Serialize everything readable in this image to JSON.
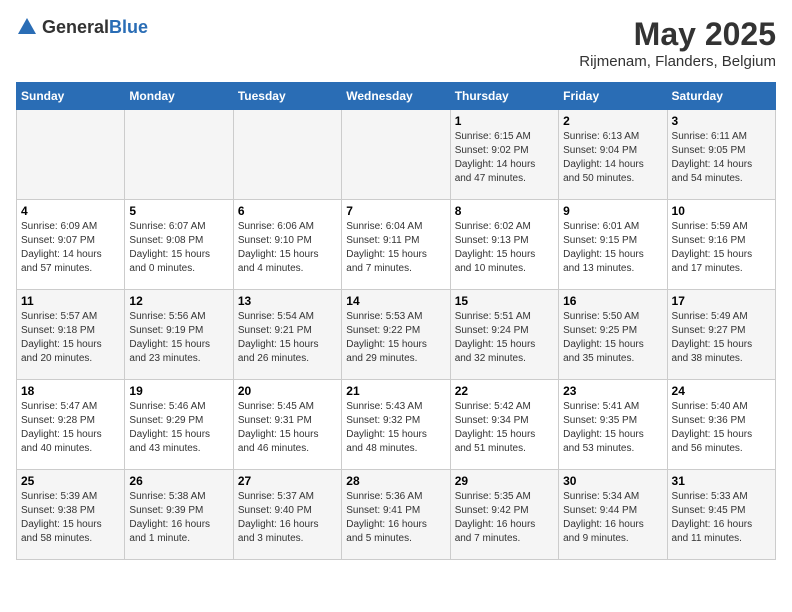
{
  "logo": {
    "text_general": "General",
    "text_blue": "Blue"
  },
  "title": "May 2025",
  "subtitle": "Rijmenam, Flanders, Belgium",
  "days_of_week": [
    "Sunday",
    "Monday",
    "Tuesday",
    "Wednesday",
    "Thursday",
    "Friday",
    "Saturday"
  ],
  "weeks": [
    [
      {
        "day": "",
        "info": ""
      },
      {
        "day": "",
        "info": ""
      },
      {
        "day": "",
        "info": ""
      },
      {
        "day": "",
        "info": ""
      },
      {
        "day": "1",
        "info": "Sunrise: 6:15 AM\nSunset: 9:02 PM\nDaylight: 14 hours\nand 47 minutes."
      },
      {
        "day": "2",
        "info": "Sunrise: 6:13 AM\nSunset: 9:04 PM\nDaylight: 14 hours\nand 50 minutes."
      },
      {
        "day": "3",
        "info": "Sunrise: 6:11 AM\nSunset: 9:05 PM\nDaylight: 14 hours\nand 54 minutes."
      }
    ],
    [
      {
        "day": "4",
        "info": "Sunrise: 6:09 AM\nSunset: 9:07 PM\nDaylight: 14 hours\nand 57 minutes."
      },
      {
        "day": "5",
        "info": "Sunrise: 6:07 AM\nSunset: 9:08 PM\nDaylight: 15 hours\nand 0 minutes."
      },
      {
        "day": "6",
        "info": "Sunrise: 6:06 AM\nSunset: 9:10 PM\nDaylight: 15 hours\nand 4 minutes."
      },
      {
        "day": "7",
        "info": "Sunrise: 6:04 AM\nSunset: 9:11 PM\nDaylight: 15 hours\nand 7 minutes."
      },
      {
        "day": "8",
        "info": "Sunrise: 6:02 AM\nSunset: 9:13 PM\nDaylight: 15 hours\nand 10 minutes."
      },
      {
        "day": "9",
        "info": "Sunrise: 6:01 AM\nSunset: 9:15 PM\nDaylight: 15 hours\nand 13 minutes."
      },
      {
        "day": "10",
        "info": "Sunrise: 5:59 AM\nSunset: 9:16 PM\nDaylight: 15 hours\nand 17 minutes."
      }
    ],
    [
      {
        "day": "11",
        "info": "Sunrise: 5:57 AM\nSunset: 9:18 PM\nDaylight: 15 hours\nand 20 minutes."
      },
      {
        "day": "12",
        "info": "Sunrise: 5:56 AM\nSunset: 9:19 PM\nDaylight: 15 hours\nand 23 minutes."
      },
      {
        "day": "13",
        "info": "Sunrise: 5:54 AM\nSunset: 9:21 PM\nDaylight: 15 hours\nand 26 minutes."
      },
      {
        "day": "14",
        "info": "Sunrise: 5:53 AM\nSunset: 9:22 PM\nDaylight: 15 hours\nand 29 minutes."
      },
      {
        "day": "15",
        "info": "Sunrise: 5:51 AM\nSunset: 9:24 PM\nDaylight: 15 hours\nand 32 minutes."
      },
      {
        "day": "16",
        "info": "Sunrise: 5:50 AM\nSunset: 9:25 PM\nDaylight: 15 hours\nand 35 minutes."
      },
      {
        "day": "17",
        "info": "Sunrise: 5:49 AM\nSunset: 9:27 PM\nDaylight: 15 hours\nand 38 minutes."
      }
    ],
    [
      {
        "day": "18",
        "info": "Sunrise: 5:47 AM\nSunset: 9:28 PM\nDaylight: 15 hours\nand 40 minutes."
      },
      {
        "day": "19",
        "info": "Sunrise: 5:46 AM\nSunset: 9:29 PM\nDaylight: 15 hours\nand 43 minutes."
      },
      {
        "day": "20",
        "info": "Sunrise: 5:45 AM\nSunset: 9:31 PM\nDaylight: 15 hours\nand 46 minutes."
      },
      {
        "day": "21",
        "info": "Sunrise: 5:43 AM\nSunset: 9:32 PM\nDaylight: 15 hours\nand 48 minutes."
      },
      {
        "day": "22",
        "info": "Sunrise: 5:42 AM\nSunset: 9:34 PM\nDaylight: 15 hours\nand 51 minutes."
      },
      {
        "day": "23",
        "info": "Sunrise: 5:41 AM\nSunset: 9:35 PM\nDaylight: 15 hours\nand 53 minutes."
      },
      {
        "day": "24",
        "info": "Sunrise: 5:40 AM\nSunset: 9:36 PM\nDaylight: 15 hours\nand 56 minutes."
      }
    ],
    [
      {
        "day": "25",
        "info": "Sunrise: 5:39 AM\nSunset: 9:38 PM\nDaylight: 15 hours\nand 58 minutes."
      },
      {
        "day": "26",
        "info": "Sunrise: 5:38 AM\nSunset: 9:39 PM\nDaylight: 16 hours\nand 1 minute."
      },
      {
        "day": "27",
        "info": "Sunrise: 5:37 AM\nSunset: 9:40 PM\nDaylight: 16 hours\nand 3 minutes."
      },
      {
        "day": "28",
        "info": "Sunrise: 5:36 AM\nSunset: 9:41 PM\nDaylight: 16 hours\nand 5 minutes."
      },
      {
        "day": "29",
        "info": "Sunrise: 5:35 AM\nSunset: 9:42 PM\nDaylight: 16 hours\nand 7 minutes."
      },
      {
        "day": "30",
        "info": "Sunrise: 5:34 AM\nSunset: 9:44 PM\nDaylight: 16 hours\nand 9 minutes."
      },
      {
        "day": "31",
        "info": "Sunrise: 5:33 AM\nSunset: 9:45 PM\nDaylight: 16 hours\nand 11 minutes."
      }
    ]
  ]
}
